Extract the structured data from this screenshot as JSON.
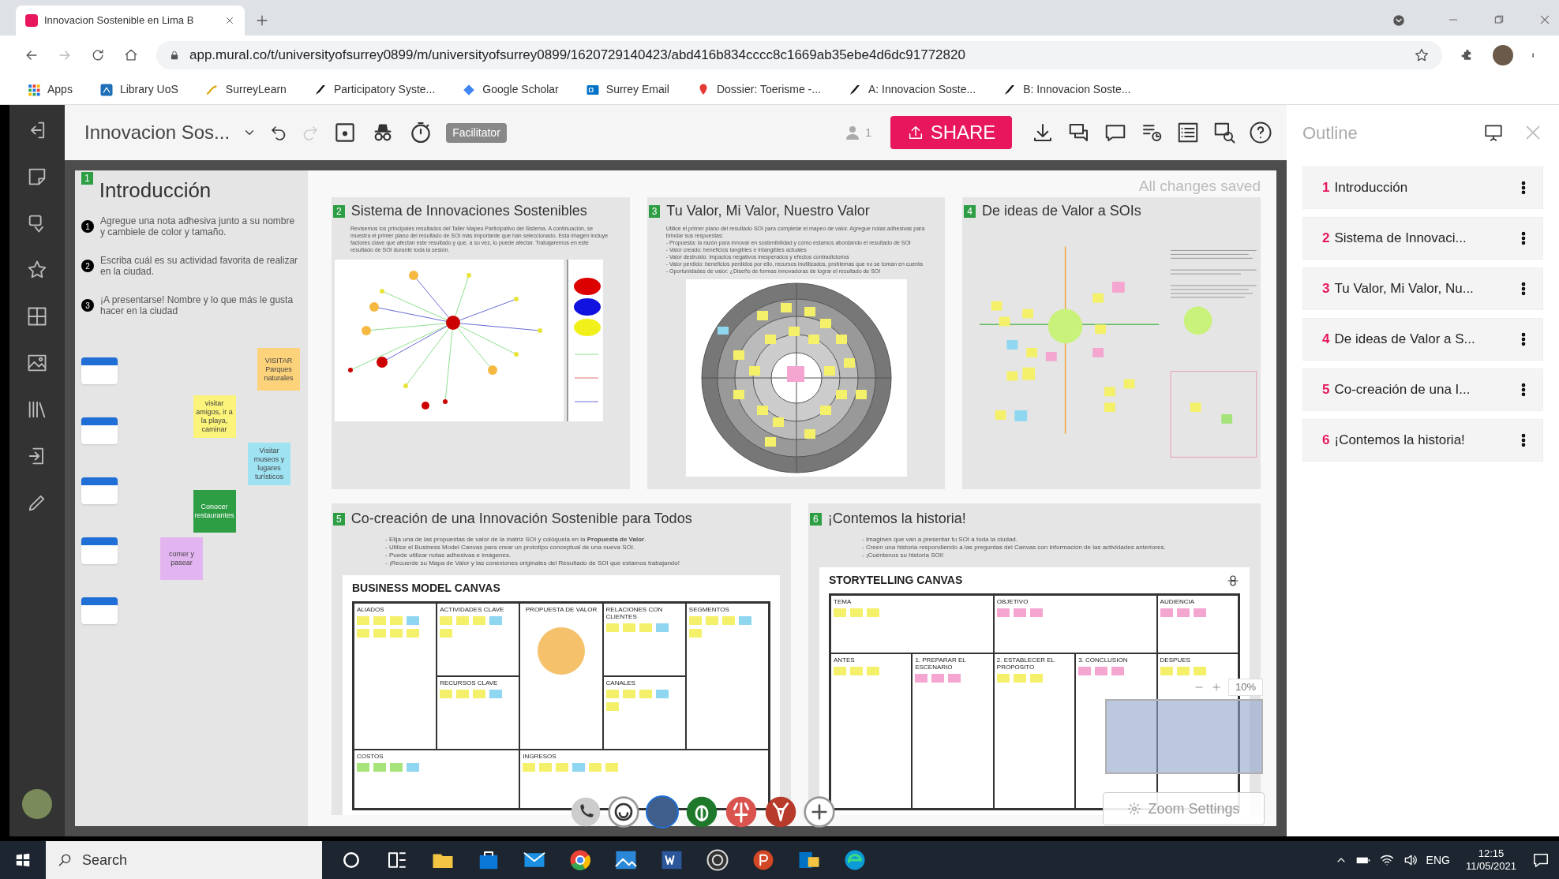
{
  "browser": {
    "tab_title": "Innovacion Sostenible en Lima B",
    "url": "app.mural.co/t/universityofsurrey0899/m/universityofsurrey0899/1620729140423/abd416b834cccc8c1669ab35ebe4d6dc91772820",
    "bookmarks": [
      {
        "label": "Apps"
      },
      {
        "label": "Library UoS"
      },
      {
        "label": "SurreyLearn"
      },
      {
        "label": "Participatory Syste..."
      },
      {
        "label": "Google Scholar"
      },
      {
        "label": "Surrey Email"
      },
      {
        "label": "Dossier: Toerisme -..."
      },
      {
        "label": "A: Innovacion Soste..."
      },
      {
        "label": "B: Innovacion Soste..."
      }
    ]
  },
  "toolbar": {
    "title": "Innovacion Sos...",
    "facilitator": "Facilitator",
    "user_count": "1",
    "share": "SHARE"
  },
  "saved_status": "All changes saved",
  "intro": {
    "number": "1",
    "title": "Introducción",
    "steps": [
      {
        "number": "1",
        "text": "Agregue una nota adhesiva junto a su nombre y cambiele de color y tamaño."
      },
      {
        "number": "2",
        "text": "Escriba cuál es su actividad favorita de realizar en la ciudad."
      },
      {
        "number": "3",
        "text": "¡A presentarse! Nombre y lo que más le gusta hacer en la ciudad"
      }
    ],
    "notes": [
      {
        "text": "VISITAR Parques naturales",
        "color": "#fcd27a"
      },
      {
        "text": "visitar amigos, ir a la playa, caminar",
        "color": "#fbf37a"
      },
      {
        "text": "Visitar museos y lugares turísticos",
        "color": "#9fe3f3"
      },
      {
        "text": "Conocer restaurantes",
        "color": "#2e9e45"
      },
      {
        "text": "comer y pasear",
        "color": "#e3b5f0"
      }
    ]
  },
  "frames": [
    {
      "number": "2",
      "title": "Sistema de Innovaciones Sostenibles",
      "kind": "network",
      "lines": [
        "Revisemos los principales resultados del Taller Mapeo Participativo del Sistema. A continuación, se muestra el primer plano del resultado de SOI más importante que han seleccionado. Esta imagen incluye factores clave que afectan este resultado y que, a su vez, lo puede afectar. Trabajaremos en este resultado de SOI durante toda la sesión."
      ]
    },
    {
      "number": "3",
      "title": "Tu Valor, Mi Valor, Nuestro Valor",
      "kind": "circles",
      "lines": [
        "Utilice el primer plano del resultado SOI para completar el mapeo de valor. Agregue notas adhesivas para brindar sus respuestas:",
        "- Propuesta: la razón para innovar en sostenibilidad y cómo estamos abordando el resultado de SOI",
        "- Valor creado: beneficios tangibles e intangibles actuales",
        "- Valor destruido: impactos negativos inesperados y efectos contradictorios",
        "- Valor perdido: beneficios perdidos por ello, recursos inutilizados, problemas que no se toman en cuenta",
        "- Oportunidades de valor: ¿Diseño de formas innovadoras de lograr el resultado de SOI"
      ]
    },
    {
      "number": "4",
      "title": "De ideas de Valor a SOIs",
      "kind": "quadrant"
    }
  ],
  "lower_frames": [
    {
      "number": "5",
      "title": "Co-creación de una Innovación Sostenible para Todos",
      "kind": "bmc",
      "lines": [
        "- Elija una de las propuestas de valor de la matriz SOI y colóquela en la **Propuesta de Valor**.",
        "- Utilice el Business Model Canvas para crear un prototipo conceptual de una nueva SOI.",
        "- Puede utilizar notas adhesivas e imágenes.",
        "- ¡Recuerde su Mapa de Valor y las conexiones originales del Resultado de SOI que estamos trabajando!"
      ],
      "canvas_title": "BUSINESS MODEL CANVAS",
      "blocks": [
        "ALIADOS",
        "ACTIVIDADES CLAVE",
        "PROPUESTA DE VALOR",
        "RELACIONES CON CLIENTES",
        "SEGMENTOS",
        "RECURSOS CLAVE",
        "CANALES",
        "COSTOS",
        "INGRESOS"
      ]
    },
    {
      "number": "6",
      "title": "¡Contemos la historia!",
      "kind": "story",
      "lines": [
        "- Imaginen que van a presentar tu SOI a toda la ciudad.",
        "- Creen una historia respondiendo a las preguntas del Canvas con información de las actividades anteriores.",
        "- ¡Cuéntenos su historia SOI!"
      ],
      "canvas_title": "STORYTELLING CANVAS",
      "blocks": [
        "TEMA",
        "OBJETIVO",
        "AUDIENCIA",
        "ANTES",
        "1. PREPARAR EL ESCENARIO",
        "2. ESTABLECER EL PROPOSITO",
        "3. CONCLUSION",
        "DESPUES"
      ]
    }
  ],
  "minimap": {
    "zoom_level": "10%"
  },
  "zoom_settings": "Zoom Settings",
  "outline": {
    "title": "Outline",
    "items": [
      {
        "number": "1",
        "label": "Introducción"
      },
      {
        "number": "2",
        "label": "Sistema de Innovaci..."
      },
      {
        "number": "3",
        "label": "Tu Valor, Mi Valor, Nu..."
      },
      {
        "number": "4",
        "label": "De ideas de Valor a S..."
      },
      {
        "number": "5",
        "label": "Co-creación de una I..."
      },
      {
        "number": "6",
        "label": "¡Contemos la historia!"
      }
    ]
  },
  "taskbar": {
    "search": "Search",
    "language": "ENG",
    "time": "12:15",
    "date": "11/05/2021"
  }
}
